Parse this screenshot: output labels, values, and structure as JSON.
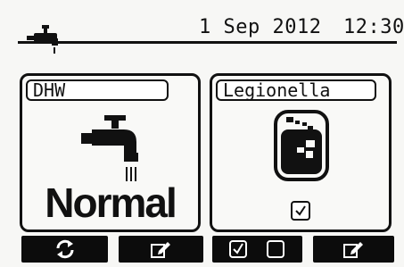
{
  "status_bar": {
    "date": "1 Sep 2012",
    "time": "12:30",
    "status_icon": "water-tap-icon"
  },
  "panels": {
    "dhw": {
      "label": "DHW",
      "icon": "water-tap-icon",
      "mode": "Normal"
    },
    "legionella": {
      "label": "Legionella",
      "icon": "tank-icon",
      "enabled": true
    }
  },
  "function_keys": {
    "f1": {
      "icon": "refresh-icon"
    },
    "f2": {
      "icon": "edit-icon"
    },
    "f3": {
      "icon": "checkbox-toggle-icon"
    },
    "f4": {
      "icon": "edit-icon"
    }
  },
  "colors": {
    "background": "#f7f7f5",
    "foreground": "#111111",
    "key_bar": "#0c0c0c"
  }
}
